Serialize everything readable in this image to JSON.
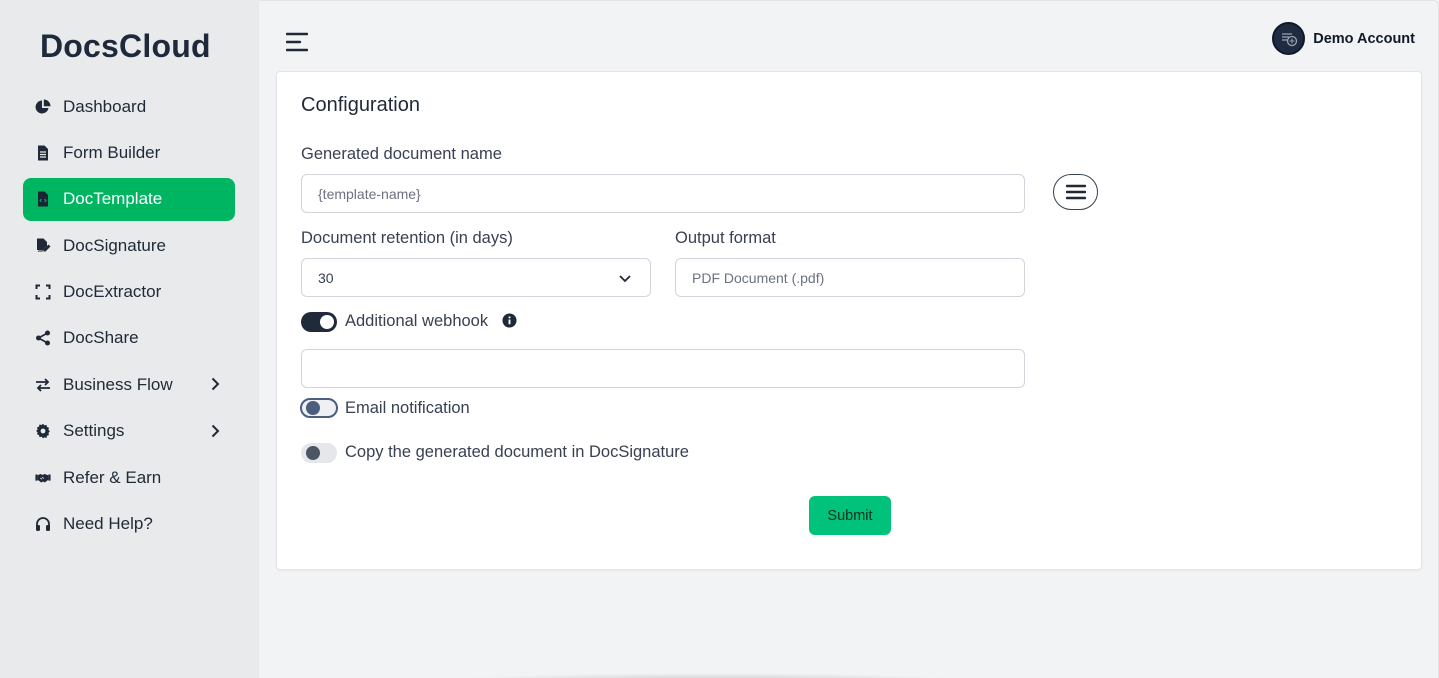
{
  "brand": "DocsCloud",
  "nav": [
    {
      "label": "Dashboard",
      "icon": "pie-chart-icon",
      "active": false,
      "has_children": false
    },
    {
      "label": "Form Builder",
      "icon": "file-text-icon",
      "active": false,
      "has_children": false
    },
    {
      "label": "DocTemplate",
      "icon": "file-code-icon",
      "active": true,
      "has_children": false
    },
    {
      "label": "DocSignature",
      "icon": "file-signature-icon",
      "active": false,
      "has_children": false
    },
    {
      "label": "DocExtractor",
      "icon": "scan-icon",
      "active": false,
      "has_children": false
    },
    {
      "label": "DocShare",
      "icon": "share-icon",
      "active": false,
      "has_children": false
    },
    {
      "label": "Business Flow",
      "icon": "arrows-exchange-icon",
      "active": false,
      "has_children": true
    },
    {
      "label": "Settings",
      "icon": "gear-icon",
      "active": false,
      "has_children": true
    },
    {
      "label": "Refer & Earn",
      "icon": "handshake-icon",
      "active": false,
      "has_children": false
    },
    {
      "label": "Need Help?",
      "icon": "headset-icon",
      "active": false,
      "has_children": false
    }
  ],
  "header": {
    "account_name": "Demo Account"
  },
  "config": {
    "title": "Configuration",
    "doc_name_label": "Generated document name",
    "doc_name_placeholder": "{template-name}",
    "retention_label": "Document retention (in days)",
    "retention_value": "30",
    "output_label": "Output format",
    "output_placeholder": "PDF Document (.pdf)",
    "webhook_label": "Additional webhook",
    "webhook_enabled": true,
    "webhook_value": "",
    "email_label": "Email notification",
    "email_enabled": false,
    "copy_label": "Copy the generated document in DocSignature",
    "copy_enabled": false,
    "submit_label": "Submit"
  },
  "colors": {
    "accent": "#00b562",
    "submit": "#00c27a",
    "dark": "#1f2a3a"
  }
}
